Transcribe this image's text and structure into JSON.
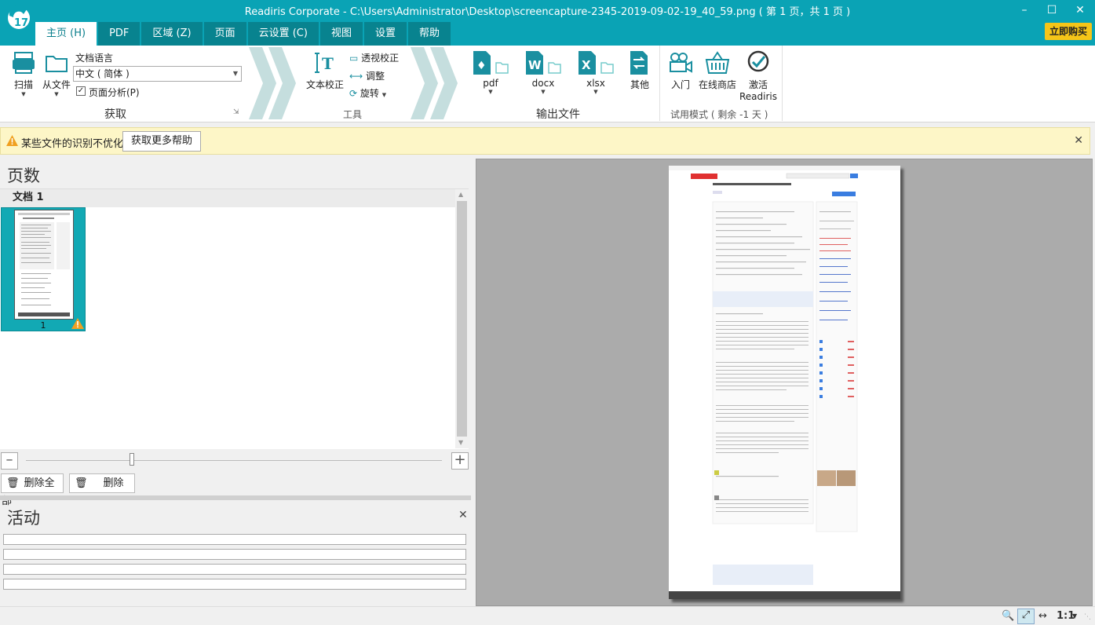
{
  "window": {
    "title": "Readiris Corporate - C:\\Users\\Administrator\\Desktop\\screencapture-2345-2019-09-02-19_40_59.png ( 第 1 页，共 1 页 )",
    "logo_text": "17",
    "buy_label": "立即购买"
  },
  "tabs": [
    "主页 (H)",
    "PDF",
    "区域 (Z)",
    "页面",
    "云设置 (C)",
    "视图",
    "设置",
    "帮助"
  ],
  "ribbon": {
    "scan_label": "扫描",
    "from_file_label": "从文件",
    "doc_lang_label": "文档语言",
    "lang_value": "中文 ( 简体 )",
    "page_analysis_label": "页面分析(P)",
    "page_analysis_checked": true,
    "acquire_group": "获取",
    "text_correct_label": "文本校正",
    "perspective_label": "透视校正",
    "adjust_label": "调整",
    "rotate_label": "旋转",
    "tools_group": "工具",
    "pdf_label": "pdf",
    "docx_label": "docx",
    "xlsx_label": "xlsx",
    "other_label": "其他",
    "output_group": "输出文件",
    "intro_label": "入门",
    "shop_label": "在线商店",
    "activate_label": "激活",
    "activate_label2": "Readiris",
    "trial_group": "试用模式 ( 剩余 -1 天 )"
  },
  "notification": {
    "message": "某些文件的识别不优化",
    "button": "获取更多帮助"
  },
  "pages_panel": {
    "title": "页数",
    "doc_header": "文档 1",
    "thumb_number": "1",
    "delete_all": "删除全部",
    "delete": "删除"
  },
  "activity_panel": {
    "title": "活动"
  },
  "statusbar": {
    "zoom_label": "1:1"
  },
  "colors": {
    "titlebar": "#0aa3b5",
    "tab_inactive": "#08838f",
    "accent_yellow": "#f5c518",
    "thumb_selected": "#12a9b4"
  }
}
